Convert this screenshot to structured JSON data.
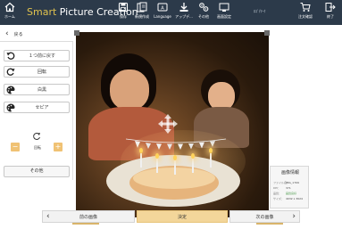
{
  "topbar": {
    "home_label": "ホーム",
    "title_brand": "Smart",
    "title_rest": " Picture Creation",
    "center_label": "ﾛｺﾞ/ﾏｰｸ",
    "buttons": [
      {
        "label": "保存",
        "icon": "save-icon"
      },
      {
        "label": "新規作成",
        "icon": "new-document-icon"
      },
      {
        "label": "Language",
        "icon": "language-icon"
      },
      {
        "label": "アップデ...",
        "icon": "download-icon"
      },
      {
        "label": "その他",
        "icon": "settings-icon"
      },
      {
        "label": "画面設定",
        "icon": "display-settings-icon"
      },
      {
        "label": "注文確認",
        "icon": "cart-icon"
      },
      {
        "label": "終了",
        "icon": "exit-icon"
      }
    ]
  },
  "left_panel": {
    "back_label": "戻る",
    "items": [
      {
        "label": "１つ前に戻す",
        "icon": "undo-icon"
      },
      {
        "label": "回転",
        "icon": "rotate-icon"
      },
      {
        "label": "白黒",
        "icon": "palette-icon"
      },
      {
        "label": "セピア",
        "icon": "palette-icon"
      }
    ],
    "rotate_label": "回転",
    "others_label": "その他"
  },
  "bottom_bar": {
    "prev_label": "前の画像",
    "ok_label": "決定",
    "next_label": "次の画像"
  },
  "info_panel": {
    "title": "画像情報",
    "rows": [
      {
        "key": "ファイル名：",
        "value": "IMG_1709"
      },
      {
        "key": "DPI：",
        "value": "371"
      },
      {
        "key": "品質：",
        "value": "画質良好"
      },
      {
        "key": "サイズ：",
        "value": "4032 x 3024"
      }
    ]
  },
  "colors": {
    "topbar_bg": "#2c3a4a",
    "brand_accent": "#e0c24e",
    "ok_button": "#f3d69a",
    "stepper_button": "#f0c274",
    "quality_good": "#4a9a4a"
  }
}
